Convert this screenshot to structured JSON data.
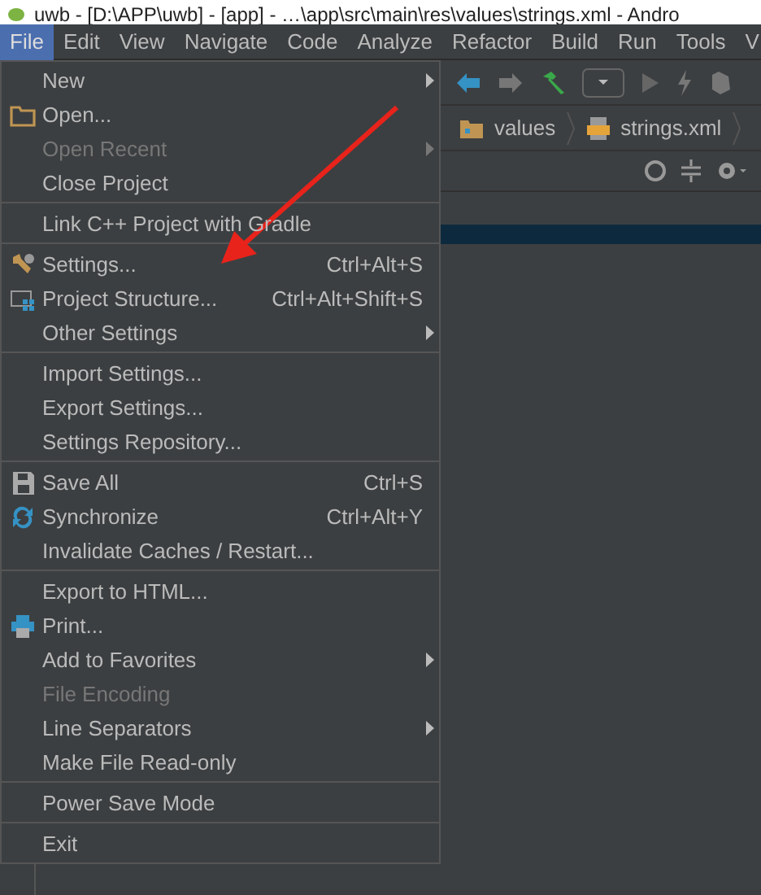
{
  "window": {
    "title": "uwb - [D:\\APP\\uwb] - [app] - …\\app\\src\\main\\res\\values\\strings.xml - Andro"
  },
  "menu_bar": [
    {
      "label": "File",
      "selected": true
    },
    {
      "label": "Edit",
      "selected": false
    },
    {
      "label": "View",
      "selected": false
    },
    {
      "label": "Navigate",
      "selected": false
    },
    {
      "label": "Code",
      "selected": false
    },
    {
      "label": "Analyze",
      "selected": false
    },
    {
      "label": "Refactor",
      "selected": false
    },
    {
      "label": "Build",
      "selected": false
    },
    {
      "label": "Run",
      "selected": false
    },
    {
      "label": "Tools",
      "selected": false
    },
    {
      "label": "V",
      "selected": false
    }
  ],
  "breadcrumb": [
    {
      "label": "values"
    },
    {
      "label": "strings.xml"
    }
  ],
  "file_menu": [
    {
      "kind": "item",
      "label": "New",
      "disabled": false,
      "submenu": true
    },
    {
      "kind": "item",
      "label": "Open...",
      "disabled": false,
      "submenu": false
    },
    {
      "kind": "item",
      "label": "Open Recent",
      "disabled": true,
      "submenu": true
    },
    {
      "kind": "item",
      "label": "Close Project",
      "disabled": false,
      "submenu": false
    },
    {
      "kind": "separator"
    },
    {
      "kind": "item",
      "label": "Link C++ Project with Gradle",
      "disabled": false,
      "submenu": false
    },
    {
      "kind": "separator"
    },
    {
      "kind": "item",
      "label": "Settings...",
      "shortcut": "Ctrl+Alt+S",
      "disabled": false,
      "submenu": false
    },
    {
      "kind": "item",
      "label": "Project Structure...",
      "shortcut": "Ctrl+Alt+Shift+S",
      "disabled": false,
      "submenu": false
    },
    {
      "kind": "item",
      "label": "Other Settings",
      "disabled": false,
      "submenu": true
    },
    {
      "kind": "separator"
    },
    {
      "kind": "item",
      "label": "Import Settings...",
      "disabled": false,
      "submenu": false
    },
    {
      "kind": "item",
      "label": "Export Settings...",
      "disabled": false,
      "submenu": false
    },
    {
      "kind": "item",
      "label": "Settings Repository...",
      "disabled": false,
      "submenu": false
    },
    {
      "kind": "separator"
    },
    {
      "kind": "item",
      "label": "Save All",
      "shortcut": "Ctrl+S",
      "disabled": false,
      "submenu": false
    },
    {
      "kind": "item",
      "label": "Synchronize",
      "shortcut": "Ctrl+Alt+Y",
      "disabled": false,
      "submenu": false
    },
    {
      "kind": "item",
      "label": "Invalidate Caches / Restart...",
      "disabled": false,
      "submenu": false
    },
    {
      "kind": "separator"
    },
    {
      "kind": "item",
      "label": "Export to HTML...",
      "disabled": false,
      "submenu": false
    },
    {
      "kind": "item",
      "label": "Print...",
      "disabled": false,
      "submenu": false
    },
    {
      "kind": "item",
      "label": "Add to Favorites",
      "disabled": false,
      "submenu": true
    },
    {
      "kind": "item",
      "label": "File Encoding",
      "disabled": true,
      "submenu": false
    },
    {
      "kind": "item",
      "label": "Line Separators",
      "disabled": false,
      "submenu": true
    },
    {
      "kind": "item",
      "label": "Make File Read-only",
      "disabled": false,
      "submenu": false
    },
    {
      "kind": "separator"
    },
    {
      "kind": "item",
      "label": "Power Save Mode",
      "disabled": false,
      "submenu": false
    },
    {
      "kind": "separator"
    },
    {
      "kind": "item",
      "label": "Exit",
      "disabled": false,
      "submenu": false
    }
  ]
}
